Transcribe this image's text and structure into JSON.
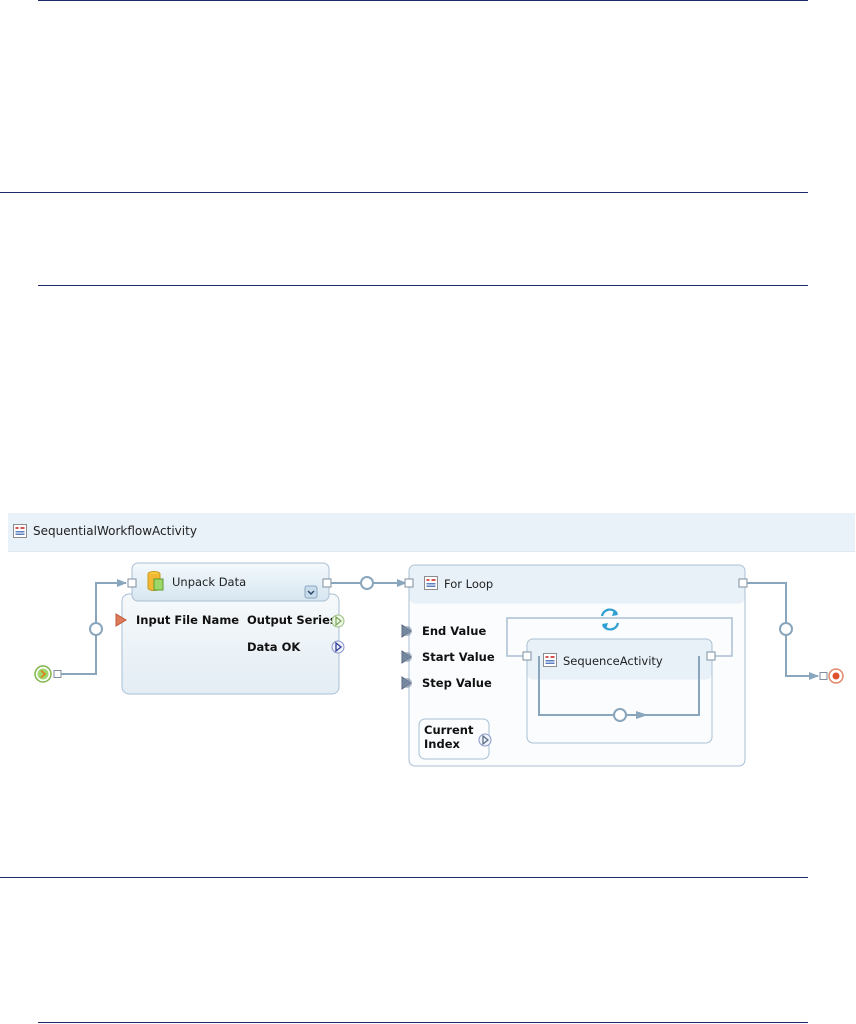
{
  "workflow": {
    "title": "SequentialWorkflowActivity"
  },
  "nodes": {
    "unpack": {
      "title": "Unpack Data",
      "input_port": "Input File Name",
      "output_ports": [
        "Output Series",
        "Data OK"
      ]
    },
    "forloop": {
      "title": "For Loop",
      "input_ports": [
        "End Value",
        "Start Value",
        "Step Value"
      ],
      "current_index": [
        "Current",
        "Index"
      ]
    },
    "sequence": {
      "title": "SequenceActivity"
    }
  },
  "colors": {
    "rule": "#1d2a6b",
    "header_bg": "#e9f1f9",
    "node_border": "#a9bfd3",
    "connector": "#8aa6bd",
    "start": "#8fd14f",
    "end": "#e05a3a",
    "input_port": "#e07b5a",
    "output_port_green": "#8bc56a",
    "output_port_blue": "#3a4fb0"
  }
}
